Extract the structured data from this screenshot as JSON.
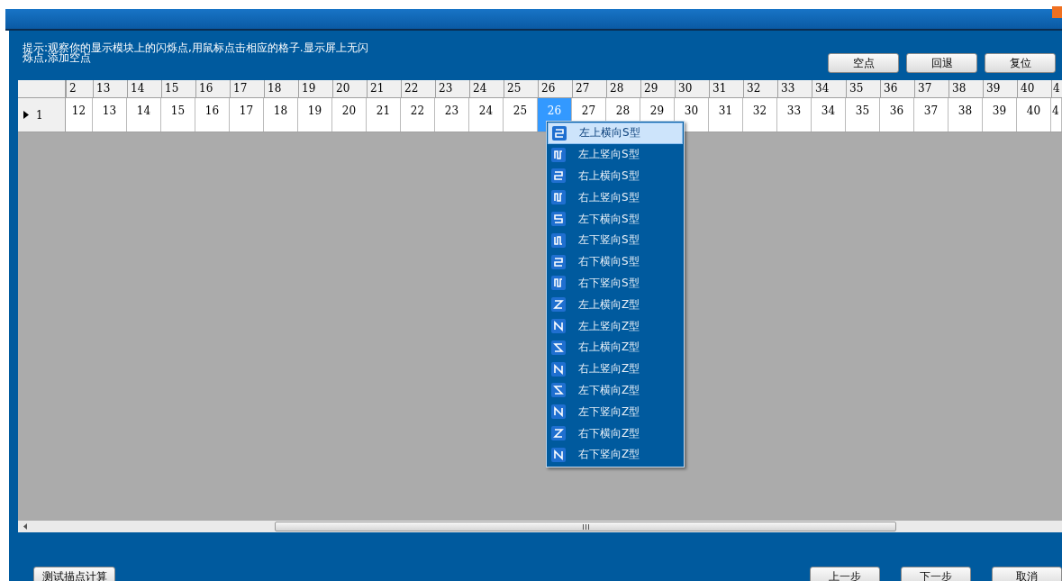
{
  "hint": "提示:观察你的显示模块上的闪烁点,用鼠标点击相应的格子.显示屏上无闪烁点,添加空点",
  "top_buttons": [
    "空点",
    "回退",
    "复位"
  ],
  "grid": {
    "row_header": {
      "label": "1",
      "current": true
    },
    "columns": [
      "2",
      "13",
      "14",
      "15",
      "16",
      "17",
      "18",
      "19",
      "20",
      "21",
      "22",
      "23",
      "24",
      "25",
      "26",
      "27",
      "28",
      "29",
      "30",
      "31",
      "32",
      "33",
      "34",
      "35",
      "36",
      "37",
      "38",
      "39",
      "40",
      "4"
    ],
    "cells": [
      {
        "text": "12",
        "selected": false
      },
      {
        "text": "13",
        "selected": false
      },
      {
        "text": "14",
        "selected": false
      },
      {
        "text": "15",
        "selected": false
      },
      {
        "text": "16",
        "selected": false
      },
      {
        "text": "17",
        "selected": false
      },
      {
        "text": "18",
        "selected": false
      },
      {
        "text": "19",
        "selected": false
      },
      {
        "text": "20",
        "selected": false
      },
      {
        "text": "21",
        "selected": false
      },
      {
        "text": "22",
        "selected": false
      },
      {
        "text": "23",
        "selected": false
      },
      {
        "text": "24",
        "selected": false
      },
      {
        "text": "25",
        "selected": false
      },
      {
        "text": "26",
        "selected": true
      },
      {
        "text": "27",
        "selected": false
      },
      {
        "text": "28",
        "selected": false
      },
      {
        "text": "29",
        "selected": false
      },
      {
        "text": "30",
        "selected": false
      },
      {
        "text": "31",
        "selected": false
      },
      {
        "text": "32",
        "selected": false
      },
      {
        "text": "33",
        "selected": false
      },
      {
        "text": "34",
        "selected": false
      },
      {
        "text": "35",
        "selected": false
      },
      {
        "text": "36",
        "selected": false
      },
      {
        "text": "37",
        "selected": false
      },
      {
        "text": "38",
        "selected": false
      },
      {
        "text": "39",
        "selected": false
      },
      {
        "text": "40",
        "selected": false
      },
      {
        "text": "4",
        "selected": false
      }
    ]
  },
  "menu": [
    {
      "label": "左上横向S型",
      "kind": "s",
      "selected": true
    },
    {
      "label": "左上竖向S型",
      "kind": "s",
      "selected": false
    },
    {
      "label": "右上横向S型",
      "kind": "s",
      "selected": false
    },
    {
      "label": "右上竖向S型",
      "kind": "s",
      "selected": false
    },
    {
      "label": "左下横向S型",
      "kind": "s",
      "selected": false
    },
    {
      "label": "左下竖向S型",
      "kind": "s",
      "selected": false
    },
    {
      "label": "右下横向S型",
      "kind": "s",
      "selected": false
    },
    {
      "label": "右下竖向S型",
      "kind": "s",
      "selected": false
    },
    {
      "label": "左上横向Z型",
      "kind": "z",
      "selected": false
    },
    {
      "label": "左上竖向Z型",
      "kind": "z",
      "selected": false
    },
    {
      "label": "右上横向Z型",
      "kind": "z",
      "selected": false
    },
    {
      "label": "右上竖向Z型",
      "kind": "z",
      "selected": false
    },
    {
      "label": "左下横向Z型",
      "kind": "z",
      "selected": false
    },
    {
      "label": "左下竖向Z型",
      "kind": "z",
      "selected": false
    },
    {
      "label": "右下横向Z型",
      "kind": "z",
      "selected": false
    },
    {
      "label": "右下竖向Z型",
      "kind": "z",
      "selected": false
    }
  ],
  "bottom_left_button": "测试描点计算",
  "bottom_buttons": [
    "上一步",
    "下一步",
    "取消"
  ]
}
